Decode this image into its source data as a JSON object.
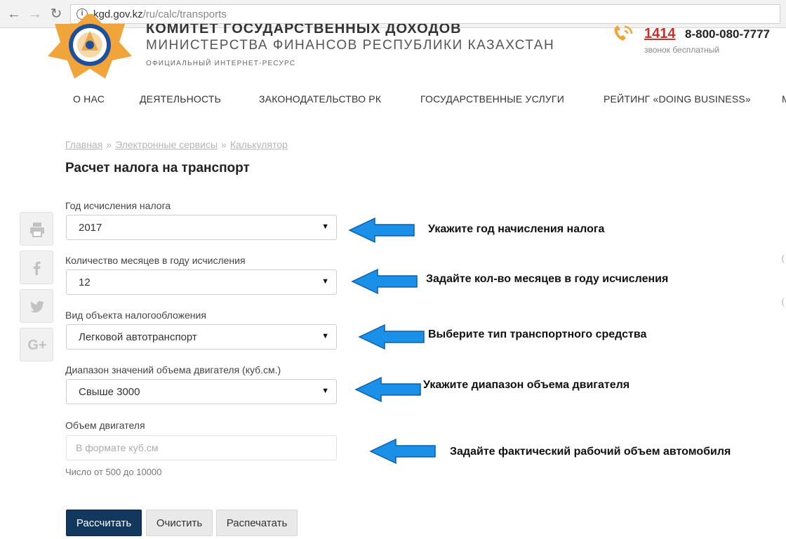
{
  "browser": {
    "back_icon": "arrow-left-icon",
    "forward_icon": "arrow-right-icon",
    "reload_icon": "reload-icon",
    "info_icon": "info-icon",
    "url_host": "kgd.gov.kz",
    "url_path": "/ru/calc/transports"
  },
  "header": {
    "org_name": "КОМИТЕТ ГОСУДАРСТВЕННЫХ ДОХОДОВ",
    "ministry": "МИНИСТЕРСТВА ФИНАНСОВ РЕСПУБЛИКИ КАЗАХСТАН",
    "resource_note": "ОФИЦИАЛЬНЫЙ ИНТЕРНЕТ-РЕСУРС",
    "hotline_short": "1414",
    "hotline_phone": "8-800-080-7777",
    "hotline_note": "звонок бесплатный",
    "colors": {
      "emblem_orange": "#f0a43a",
      "emblem_blue": "#1e4f9a",
      "hotline_red": "#c8302c"
    }
  },
  "menu": {
    "items": [
      {
        "label": "О НАС"
      },
      {
        "label": "ДЕЯТЕЛЬНОСТЬ"
      },
      {
        "label": "ЗАКОНОДАТЕЛЬСТВО РК"
      },
      {
        "label": "ГОСУДАРСТВЕННЫЕ УСЛУГИ"
      },
      {
        "label": "РЕЙТИНГ «DOING BUSINESS»"
      },
      {
        "label": "М"
      }
    ]
  },
  "breadcrumb": {
    "items": [
      "Главная",
      "Электронные сервисы",
      "Калькулятор"
    ],
    "separator": "»"
  },
  "page": {
    "title": "Расчет налога на транспорт"
  },
  "share": {
    "icons": [
      "print-icon",
      "facebook-icon",
      "twitter-icon",
      "google-plus-icon"
    ],
    "google_plus_text": "G+"
  },
  "form": {
    "year": {
      "label": "Год исчисления налога",
      "value": "2017"
    },
    "months": {
      "label": "Количество месяцев в году исчисления",
      "value": "12"
    },
    "object_type": {
      "label": "Вид объекта налогообложения",
      "value": "Легковой автотранспорт"
    },
    "engine_range": {
      "label": "Диапазон значений объема двигателя (куб.см.)",
      "value": "Свыше 3000"
    },
    "engine_volume": {
      "label": "Объем двигателя",
      "placeholder": "В формате куб.см",
      "value": "",
      "help": "Число от 500 до 10000"
    },
    "caret": "▼"
  },
  "buttons": {
    "calculate": "Рассчитать",
    "clear": "Очистить",
    "print": "Распечатать"
  },
  "annotations": {
    "year": "Укажите год начисления налога",
    "months": "Задайте кол-во месяцев в году исчисления",
    "object_type": "Выберите тип транспортного средства",
    "engine_range": "Укажите диапазон объема двигателя",
    "engine_volume": "Задайте фактический рабочий объем автомобиля",
    "arrow_color": "#1a90e8"
  }
}
